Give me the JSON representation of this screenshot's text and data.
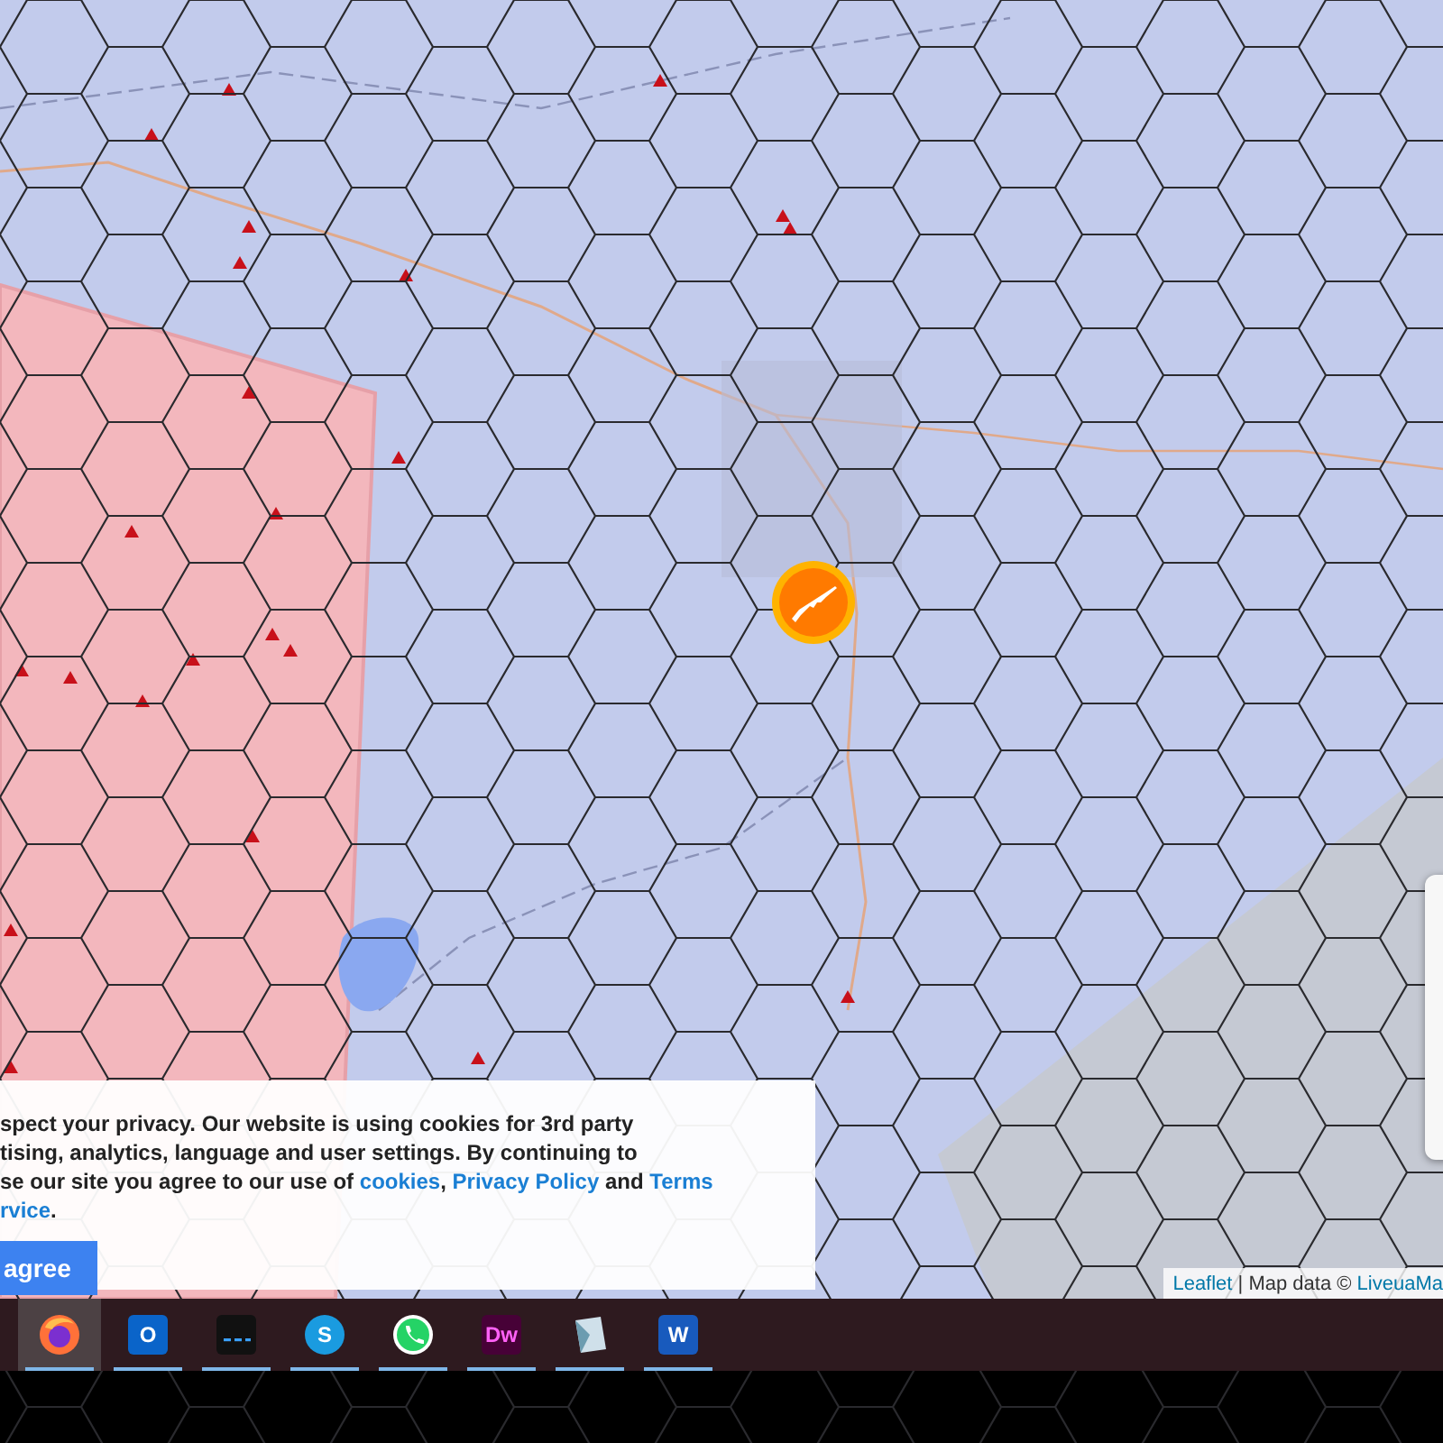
{
  "cookie_banner": {
    "lines": [
      [
        {
          "kind": "text",
          "text": "spect your privacy. Our website is using cookies for 3rd party"
        }
      ],
      [
        {
          "kind": "text",
          "text": "tising, analytics, language and user settings. By continuing to"
        }
      ],
      [
        {
          "kind": "text",
          "text": "se our site you agree to our use of "
        },
        {
          "kind": "link",
          "text": "cookies"
        },
        {
          "kind": "text",
          "text": ", "
        },
        {
          "kind": "link",
          "text": "Privacy Policy"
        },
        {
          "kind": "text",
          "text": " and "
        },
        {
          "kind": "link",
          "text": "Terms"
        }
      ],
      [
        {
          "kind": "link",
          "text": "rvice"
        },
        {
          "kind": "text",
          "text": "."
        }
      ]
    ],
    "button": "agree"
  },
  "attribution": [
    {
      "kind": "link",
      "text": "Leaflet"
    },
    {
      "kind": "text",
      "text": " | Map data © "
    },
    {
      "kind": "link",
      "text": "LiveuaMa"
    }
  ],
  "taskbar": [
    {
      "kind": "firefox",
      "selected": true,
      "running": true
    },
    {
      "kind": "outlook",
      "glyph": "O",
      "selected": false,
      "running": true
    },
    {
      "kind": "terminal",
      "selected": false,
      "running": true
    },
    {
      "kind": "skype",
      "glyph": "S",
      "selected": false,
      "running": true
    },
    {
      "kind": "whatsapp",
      "selected": false,
      "running": true
    },
    {
      "kind": "dreamweaver",
      "glyph": "Dw",
      "selected": false,
      "running": true
    },
    {
      "kind": "notes",
      "selected": false,
      "running": true
    },
    {
      "kind": "word",
      "glyph": "W",
      "selected": false,
      "running": true
    }
  ]
}
